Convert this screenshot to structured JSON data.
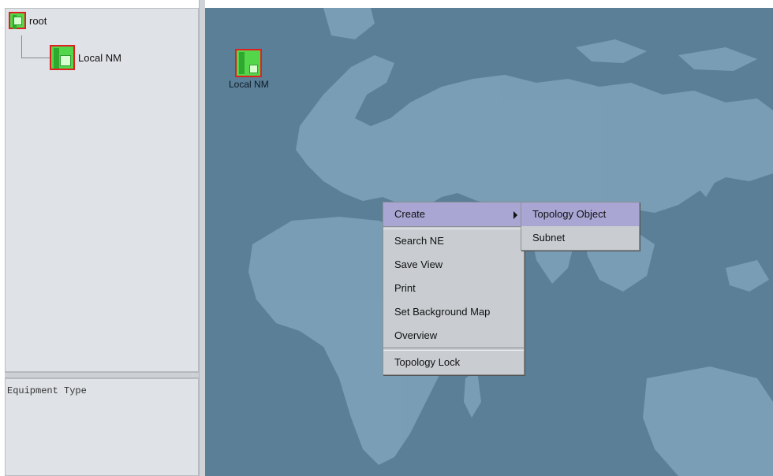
{
  "tree": {
    "root_label": "root",
    "child_label": "Local NM"
  },
  "equipment": {
    "label": "Equipment Type"
  },
  "map": {
    "node_label": "Local NM"
  },
  "context_menu": {
    "items": [
      {
        "label": "Create",
        "has_submenu": true
      },
      {
        "label": "Search NE"
      },
      {
        "label": "Save View"
      },
      {
        "label": "Print"
      },
      {
        "label": "Set Background Map"
      },
      {
        "label": "Overview"
      },
      {
        "label": "Topology Lock"
      }
    ]
  },
  "submenu": {
    "items": [
      {
        "label": "Topology Object"
      },
      {
        "label": "Subnet"
      }
    ]
  },
  "colors": {
    "map_ocean": "#5a7f97",
    "map_land": "#7fa3ba",
    "menu_bg": "#c9cdd1",
    "menu_highlight": "#a9a6d4",
    "node_green": "#54d64a",
    "node_border": "#e02020"
  }
}
